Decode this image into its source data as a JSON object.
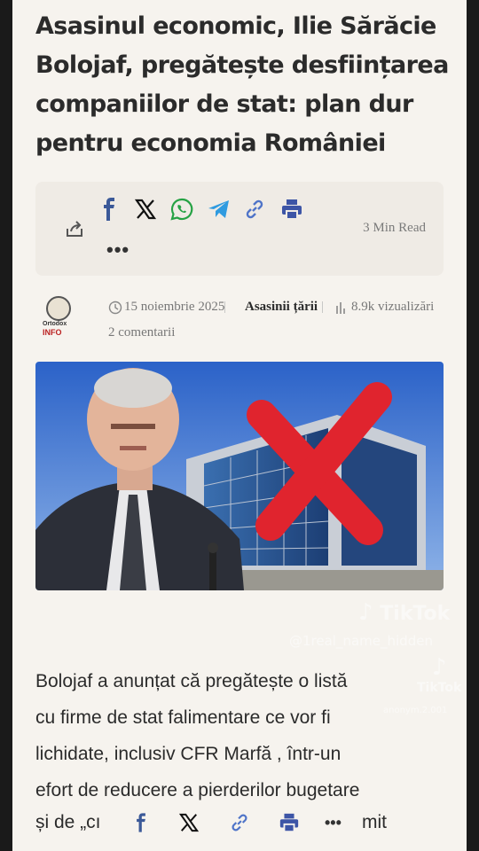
{
  "article": {
    "headline": "Asasinul economic, Ilie Sărăcie Bolojaf, pregătește desființarea companiilor de stat: plan dur pentru economia României",
    "headline_lines": [
      "Asasinul economic, Ilie Sărăcie",
      "Bolojaf, pregătește desființarea",
      "companiilor de stat: plan dur",
      "pentru economia României"
    ],
    "read_time": "3 Min Read",
    "more": "•••",
    "meta": {
      "logo_line1": "Ortodox",
      "logo_line2": "INFO",
      "date": "15 noiembrie 2025",
      "author": "Asasinii țării",
      "views": "8.9k vizualizări",
      "comments": "2 comentarii"
    },
    "body_lines": [
      "Bolojaf a anunțat că pregătește o listă",
      "cu firme de stat falimentare ce vor fi",
      "lichidate, inclusiv CFR Marfă , într-un",
      "efort de reducere a pierderilor bugetare"
    ],
    "body_partial_start": "și de „cı",
    "body_partial_end": "mit"
  },
  "share": {
    "icons": [
      "facebook-icon",
      "x-icon",
      "whatsapp-icon",
      "telegram-icon",
      "link-icon",
      "print-icon"
    ],
    "colors": {
      "facebook": "#3b5998",
      "x": "#111111",
      "whatsapp": "#25a244",
      "telegram": "#2f9be0",
      "link": "#4f74c8",
      "print": "#3d55a6"
    }
  },
  "watermark": {
    "brand": "TikTok",
    "user1": "@1real_name_hidden",
    "user2": "anonym.2.001"
  }
}
